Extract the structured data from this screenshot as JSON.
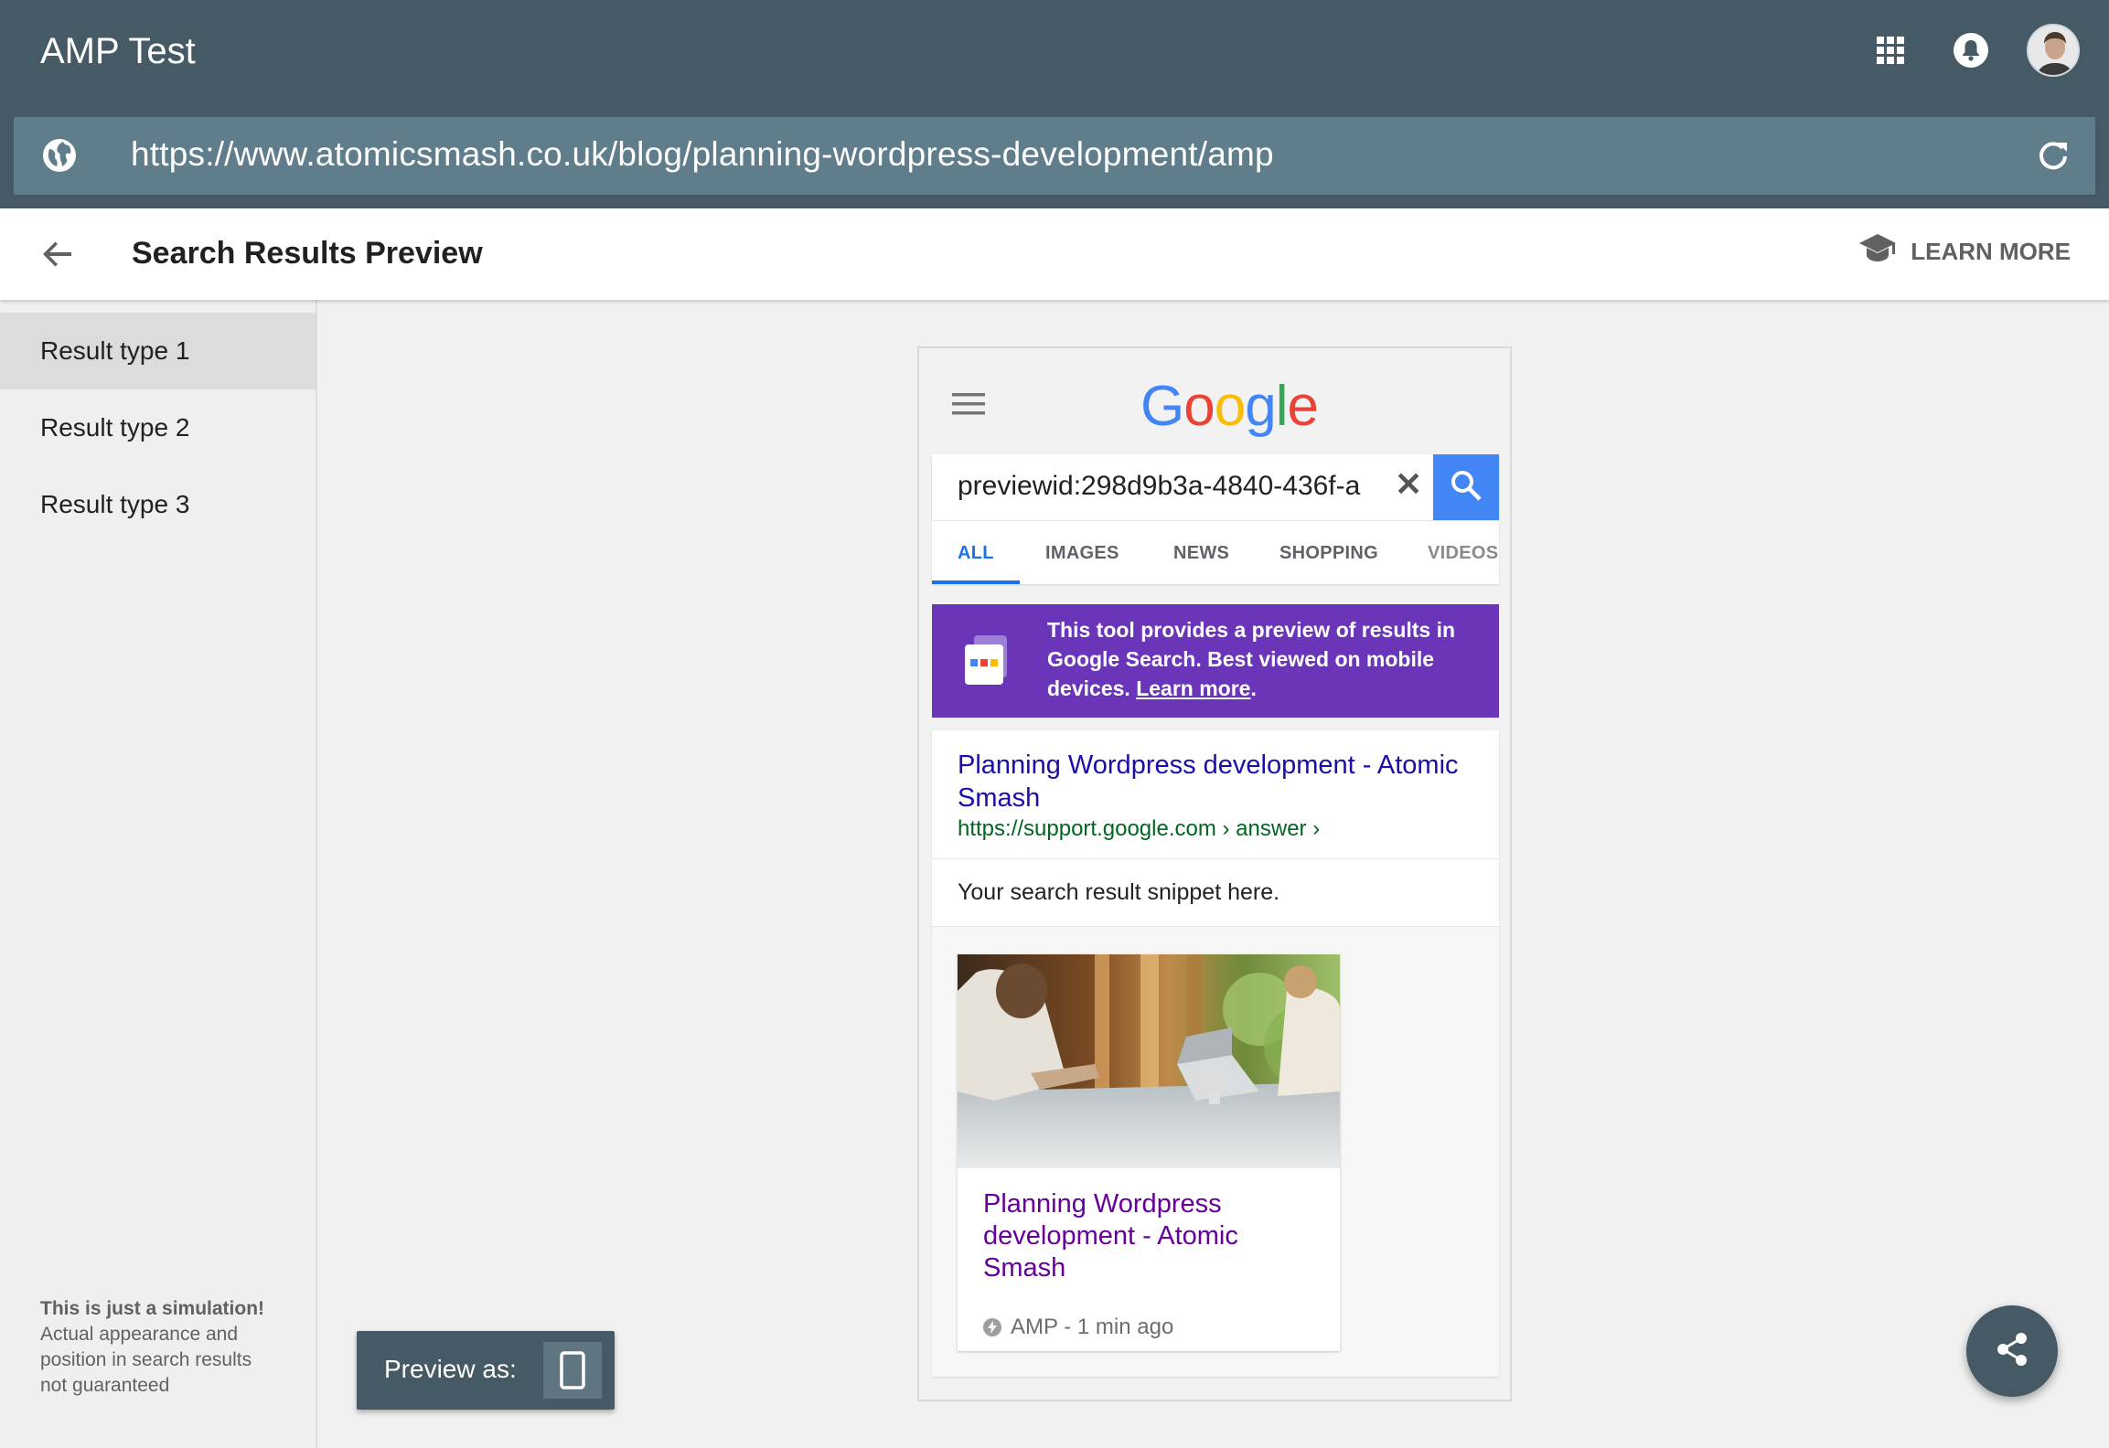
{
  "app": {
    "title": "AMP Test"
  },
  "url": {
    "value": "https://www.atomicsmash.co.uk/blog/planning-wordpress-development/amp"
  },
  "header": {
    "page_title": "Search Results Preview",
    "learn_more": "LEARN MORE"
  },
  "sidebar": {
    "items": [
      {
        "label": "Result type 1",
        "active": true
      },
      {
        "label": "Result type 2",
        "active": false
      },
      {
        "label": "Result type 3",
        "active": false
      }
    ],
    "disclaimer_bold": "This is just a simulation!",
    "disclaimer_text": "Actual appearance and position in search results not guaranteed"
  },
  "preview": {
    "label": "Preview as:",
    "device_icon": "smartphone-icon"
  },
  "phone": {
    "logo_text": "Google",
    "search_query": "previewid:298d9b3a-4840-436f-a",
    "tabs": [
      "ALL",
      "IMAGES",
      "NEWS",
      "SHOPPING",
      "VIDEOS"
    ],
    "active_tab": "ALL",
    "banner": {
      "text_before": "This tool provides a preview of results in Google Search. Best viewed on mobile devices. ",
      "link": "Learn more",
      "text_after": "."
    },
    "result": {
      "title": "Planning Wordpress development - Atomic Smash",
      "url": "https://support.google.com › answer ›",
      "snippet": "Your search result snippet here."
    },
    "amp_card": {
      "title": "Planning Wordpress development - Atomic Smash",
      "meta": "AMP - 1 min ago"
    }
  },
  "colors": {
    "topbar": "#455a64",
    "urlbar": "#607d8b",
    "banner": "#6a35b8",
    "search_button": "#4285f4",
    "link_blue": "#1a0dab",
    "link_visited": "#660099",
    "url_green": "#006621"
  }
}
